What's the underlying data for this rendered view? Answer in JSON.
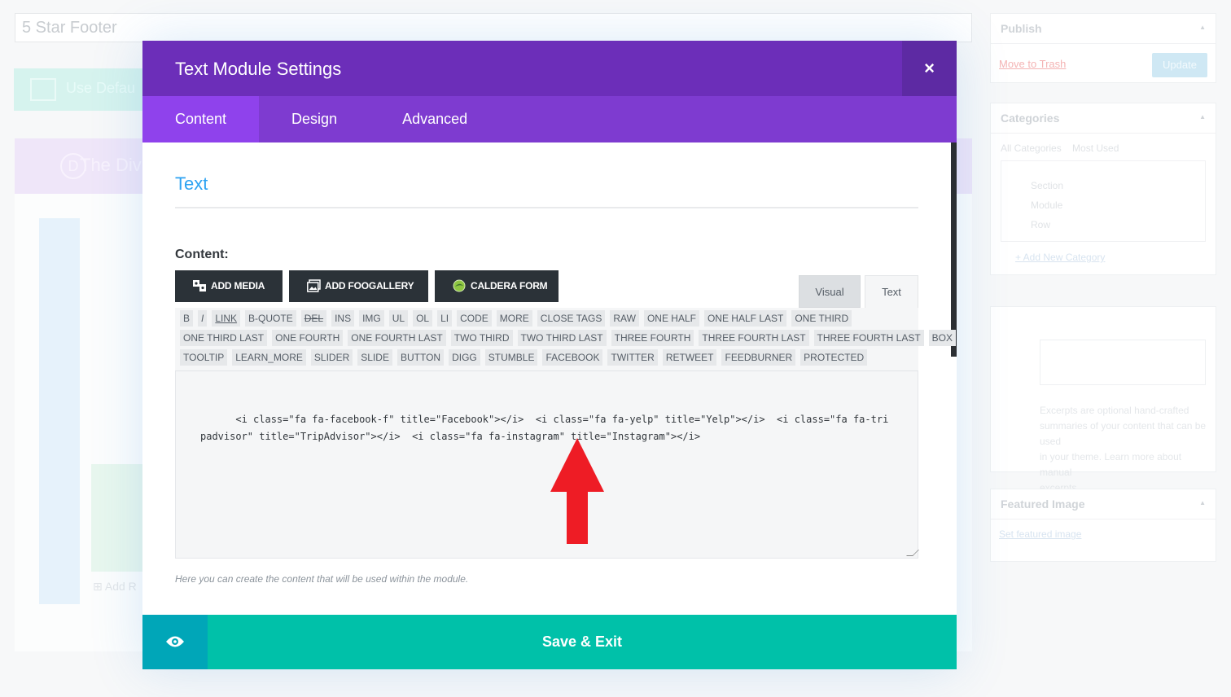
{
  "background": {
    "page_title": "5 Star Footer",
    "use_default_label": "Use Defau",
    "builder_label": "The Divi",
    "add_row_label": "Add R",
    "publish_box": {
      "title": "Publish",
      "trash_link": "Move to Trash",
      "update_button": "Update"
    },
    "categories_box": {
      "title": "Categories",
      "tab_all": "All Categories",
      "tab_most": "Most Used",
      "items": [
        "Section",
        "Module",
        "Row"
      ],
      "add_new": "+ Add New Category"
    },
    "excerpt_box": {
      "desc_lines": [
        "Excerpts are optional hand-crafted",
        "summaries of your content that can be used",
        "in your theme. Learn more about manual",
        "excerpts."
      ]
    },
    "featured_box": {
      "title": "Featured Image",
      "link": "Set featured image"
    }
  },
  "modal": {
    "title": "Text Module Settings",
    "close_glyph": "×",
    "tabs": [
      {
        "label": "Content"
      },
      {
        "label": "Design"
      },
      {
        "label": "Advanced"
      }
    ],
    "section_title": "Text",
    "field_label": "Content:",
    "media_buttons": {
      "add_media": "ADD MEDIA",
      "add_foogallery": "ADD FOOGALLERY",
      "caldera_form": "CALDERA FORM"
    },
    "editor_tabs": {
      "visual": "Visual",
      "text": "Text"
    },
    "quicktags": [
      [
        "B",
        "I",
        "LINK",
        "B-QUOTE",
        "DEL",
        "INS",
        "IMG",
        "UL",
        "OL",
        "LI",
        "CODE",
        "MORE",
        "CLOSE TAGS",
        "RAW",
        "ONE HALF",
        "ONE HALF LAST",
        "ONE THIRD"
      ],
      [
        "ONE THIRD LAST",
        "ONE FOURTH",
        "ONE FOURTH LAST",
        "TWO THIRD",
        "TWO THIRD LAST",
        "THREE FOURTH",
        "THREE FOURTH LAST",
        "THREE FOURTH LAST",
        "BOX"
      ],
      [
        "TOOLTIP",
        "LEARN_MORE",
        "SLIDER",
        "SLIDE",
        "BUTTON",
        "DIGG",
        "STUMBLE",
        "FACEBOOK",
        "TWITTER",
        "RETWEET",
        "FEEDBURNER",
        "PROTECTED"
      ]
    ],
    "editor_content": "<i class=\"fa fa-facebook-f\" title=\"Facebook\"></i>  <i class=\"fa fa-yelp\" title=\"Yelp\"></i>  <i class=\"fa fa-tripadvisor\" title=\"TripAdvisor\"></i>  <i class=\"fa fa-instagram\" title=\"Instagram\"></i>",
    "help_text": "Here you can create the content that will be used within the module.",
    "save_button": "Save & Exit",
    "preview_icon": "eye-icon"
  },
  "colors": {
    "header": "#6c2eb9",
    "tabs_bar": "#7e3bd0",
    "active_tab": "#8f42ec",
    "save": "#00c1a9",
    "preview": "#00a6b8",
    "accent_blue": "#2ea3f2",
    "arrow": "#ee1c25"
  }
}
